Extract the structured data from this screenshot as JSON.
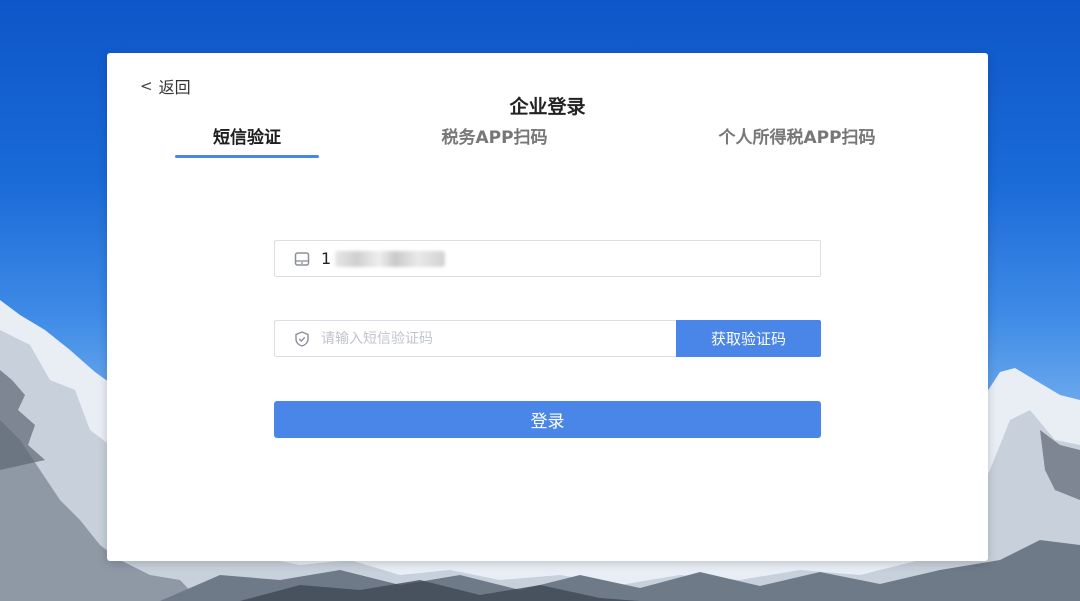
{
  "header": {
    "back_label": "返回",
    "title": "企业登录"
  },
  "tabs": [
    {
      "label": "短信验证",
      "active": true
    },
    {
      "label": "税务APP扫码",
      "active": false
    },
    {
      "label": "个人所得税APP扫码",
      "active": false
    }
  ],
  "form": {
    "phone_value_visible": "1",
    "code_placeholder": "请输入短信验证码",
    "get_code_label": "获取验证码",
    "login_label": "登录"
  },
  "colors": {
    "accent": "#4a86e8",
    "sky_top": "#0d56c9",
    "sky_bottom": "#a9cff7"
  },
  "icons": {
    "back": "chevron-left-icon",
    "phone": "mobile-phone-icon",
    "code": "shield-check-icon"
  }
}
